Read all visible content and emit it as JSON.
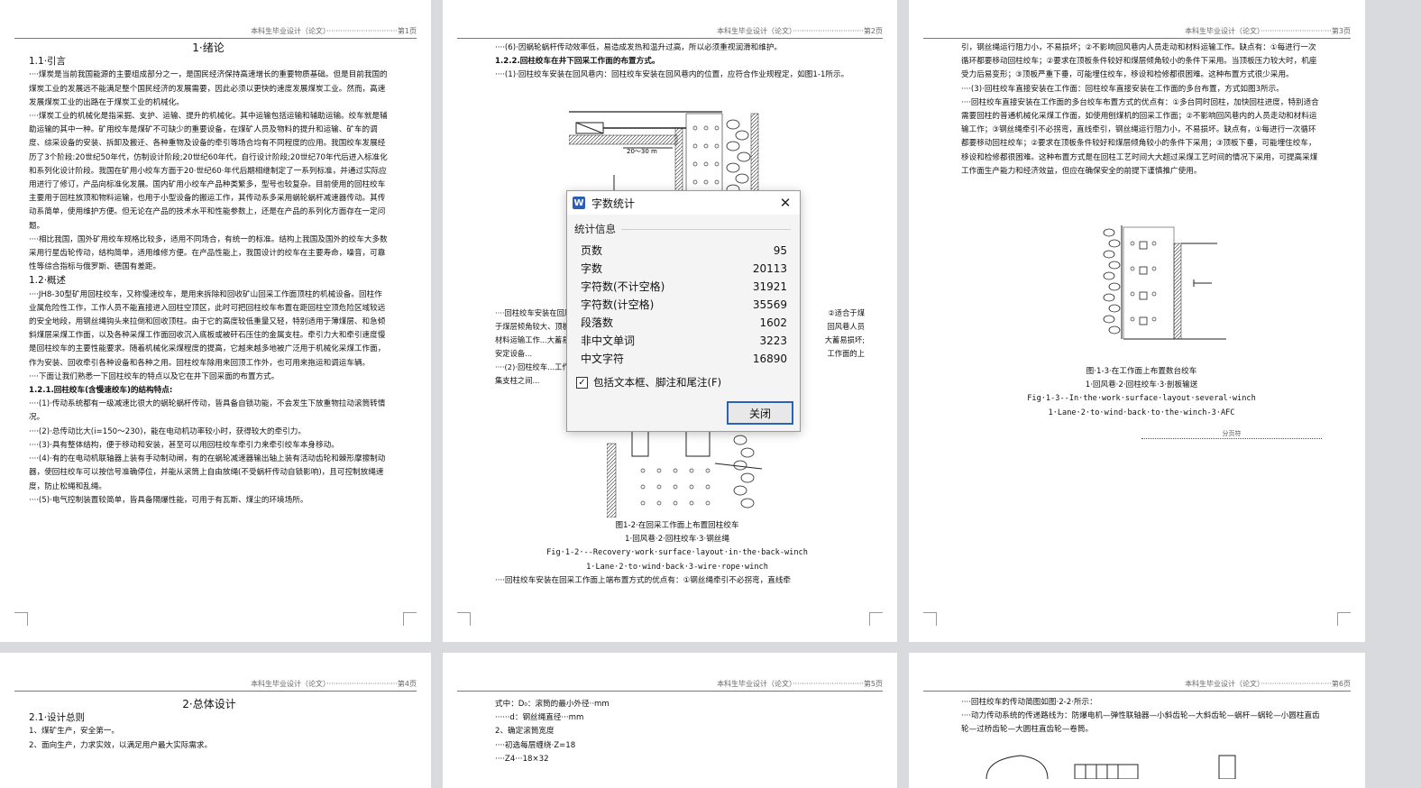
{
  "header_text": "本科生毕业设计（论文）·······························",
  "pages": {
    "p1": {
      "num": "第1页",
      "title": "1·绪论",
      "h_intro": "1.1·引言",
      "intro": [
        "····煤炭是当前我国能源的主要组成部分之一，是国民经济保持高速增长的重要物质基础。但是目前我国的煤炭工业的发展远不能满足整个国民经济的发展需要，因此必须以更快的速度发展煤炭工业。然而，高速发展煤炭工业的出路在于煤炭工业的机械化。",
        "····煤炭工业的机械化是指采掘、支护、运输、提升的机械化。其中运输包括运输和辅助运输。绞车就是辅助运输的其中一种。矿用绞车是煤矿不可缺少的重要设备，在煤矿人员及物料的提升和运输、矿车的调度、综采设备的安装、拆卸及搬迁、各种重物及设备的牵引等场合均有不同程度的应用。我国绞车发展经历了3个阶段:20世纪50年代，仿制设计阶段;20世纪60年代，自行设计阶段;20世纪70年代后进入标准化和系列化设计阶段。我国在矿用小绞车方面于20·世纪60·年代后期相继制定了一系列标准，并通过实际应用进行了修订，产品向标准化发展。国内矿用小绞车产品种类繁多，型号也较复杂。目前使用的回柱绞车主要用于回柱放顶和物料运输，也用于小型设备的搬运工作，其传动系多采用蜗轮蜗杆减速器传动。其传动系简单，使用维护方便。但无论在产品的技术水平和性能参数上，还是在产品的系列化方面存在一定问题。",
        "····相比我国，国外矿用绞车规格比较多，适用不同场合，有统一的标准。结构上我国及国外的绞车大多数采用行星齿轮传动，结构简单，适用维修方便。在产品性能上，我国设计的绞车在主要寿命，噪音，可靠性等综合指标与俄罗斯、德国有差距。"
      ],
      "h_overview": "1.2·概述",
      "overview": [
        "····JH8-30型矿用回柱绞车，又称慢速绞车，是用来拆除和回收矿山回采工作面顶柱的机械设备。回柱作业属危险性工作，工作人员不能直接进入回柱空顶区，此时可把回柱绞车布置在距回柱空顶危险区域较远的安全地段，用钢丝绳钩头来拉倒和回收顶柱。由于它的高度较低重量又轻，特别适用于薄煤层、和急倾斜煤层采煤工作面，以及各种采煤工作面回收沉入底板或被矸石压住的金属支柱。牵引力大和牵引速度慢是回柱绞车的主要性能要求。随着机械化采煤程度的提高，它越来越多地被广泛用于机械化采煤工作面，作为安装、回收牵引各种设备和各种之用。回柱绞车除用来回顶工作外，也可用来拖运和调运车辆。",
        "····下面让我们熟悉一下回柱绞车的特点以及它在井下回采面的布置方式。"
      ],
      "h_features": "1.2.1.回柱绞车(含慢速绞车)的结构特点:",
      "features": [
        "····(1)·传动系统都有一级减速比很大的蜗轮蜗杆传动，皆具备自锁功能，不会发生下放重物拉动滚筒转情况。",
        "····(2)·总传动比大(i=150～230)，能在电动机功率较小时，获得较大的牵引力。",
        "····(3)·具有整体结构，便于移动和安装，甚至可以用回柱绞车牵引力来牵引绞车本身移动。",
        "····(4)·有的在电动机联轴器上装有手动制动闸，有的在蜗轮减速器输出轴上装有活动齿轮和棘形摩擦制动器，使回柱绞车可以按信号准确停位，并能从滚筒上自由放绳(不受蜗杆传动自锁影响)，且可控制放绳速度，防止松绳和乱绳。",
        "····(5)·电气控制装置较简单，皆具备隔爆性能，可用于有瓦斯、煤尘的环境场所。"
      ]
    },
    "p2": {
      "num": "第2页",
      "lines": [
        "····(6)·因蜗轮蜗杆传动效率低，易造成发热和温升过高，所以必须重视润滑和维护。",
        "1.2.2.回柱绞车在井下回采工作面的布置方式。",
        "····(1)·回柱绞车安装在回风巷内：回柱绞车安装在回风巷内的位置，应符合作业规程定，如图1-1所示。"
      ],
      "mid_lines": [
        "····回柱绞车安装在回风巷内，...适合于煤层倾角较大、顶板...人员行走和材料运输工作...大蓄易损坏；②要求安定设备...",
        "····(2)·回柱绞车...工作面的上端布密集支柱之间..."
      ],
      "fig_label": "20～30 m",
      "cap1": "图1-2·在回采工作面上布置回柱绞车",
      "cap2": "1·回风巷·2·回柱绞车·3·钢丝绳",
      "cap3": "Fig·1-2·--Recovery·work·surface·layout·in·the·back-winch",
      "cap4": "1·Lane·2·to·wind·back·3-wire·rope·winch",
      "tail": "····回柱绞车安装在回采工作面上端布置方式的优点有：①钢丝绳牵引不必拐弯，直线牵"
    },
    "p3": {
      "num": "第3页",
      "lines": [
        "引，钢丝绳运行阻力小，不易损坏；②不影响回风巷内人员走动和材料运输工作。缺点有：①每进行一次循环都要移动回柱绞车；②要求在顶板条件较好和煤层倾角较小的条件下采用。当顶板压力较大时，机座受力后易变形；③顶板严重下垂，可能埋住绞车，移设和检修都很困难。这种布置方式很少采用。",
        "····(3)·回柱绞车直接安装在工作面：回柱绞车直接安装在工作面的多台布置，方式如图3所示。",
        "····回柱绞车直接安装在工作面的多台绞车布置方式的优点有：①多台同时回柱，加快回柱进度，特别适合需要回柱的普通机械化采煤工作面，如使用刨煤机的回采工作面；②不影响回风巷内的人员走动和材料运输工作；③钢丝绳牵引不必拐弯，直线牵引，钢丝绳运行阻力小，不易损坏。缺点有，①每进行一次循环都要移动回柱绞车；②要求在顶板条件较好和煤层倾角较小的条件下采用；③顶板下垂，可能埋住绞车，移设和检修都很困难。这种布置方式是在回柱工艺时间大大超过采煤工艺时间的情况下采用，可提高采煤工作面生产能力和经济效益，但应在确保安全的前提下谨慎推广使用。"
      ],
      "cap1": "图·1-3·在工作面上布置数台绞车",
      "cap2": "1·回风巷·2·回柱绞车·3·剖板输送",
      "cap3": "Fig·1-3--In·the·work·surface·layout·several·winch",
      "cap4": "1·Lane·2·to·wind·back·to·the·winch-3·AFC",
      "section_break": "分页符"
    },
    "p4": {
      "num": "第4页",
      "title": "2·总体设计",
      "h1": "2.1·设计总则",
      "l1": "1、煤矿生产，安全第一。",
      "l2": "2、面向生产，力求实效，以满足用户最大实际需求。"
    },
    "p5": {
      "num": "第5页",
      "l1": "式中：D₀：滚筒的最小外径··mm",
      "l2": "······d：钢丝绳直径···mm",
      "l3": "2、确定滚筒宽度",
      "l4": "····初选每层缠绕·Z=18",
      "l5": "····Z4···18×32"
    },
    "p6": {
      "num": "第6页",
      "l1": "····回柱绞车的传动简图如图·2-2·所示：",
      "l2": "····动力传动系统的传递路线为：防爆电机—弹性联轴器—小斜齿轮—大斜齿轮—蜗杆—蜗轮—小圆柱直齿轮—过桥齿轮—大圆柱直齿轮—卷筒。"
    }
  },
  "dialog": {
    "title": "字数统计",
    "section": "统计信息",
    "stats": [
      {
        "label": "页数",
        "value": "95"
      },
      {
        "label": "字数",
        "value": "20113"
      },
      {
        "label": "字符数(不计空格)",
        "value": "31921"
      },
      {
        "label": "字符数(计空格)",
        "value": "35569"
      },
      {
        "label": "段落数",
        "value": "1602"
      },
      {
        "label": "非中文单词",
        "value": "3223"
      },
      {
        "label": "中文字符",
        "value": "16890"
      }
    ],
    "checkbox_label": "包括文本框、脚注和尾注(F)",
    "checkbox_checked": true,
    "close_label": "关闭"
  }
}
